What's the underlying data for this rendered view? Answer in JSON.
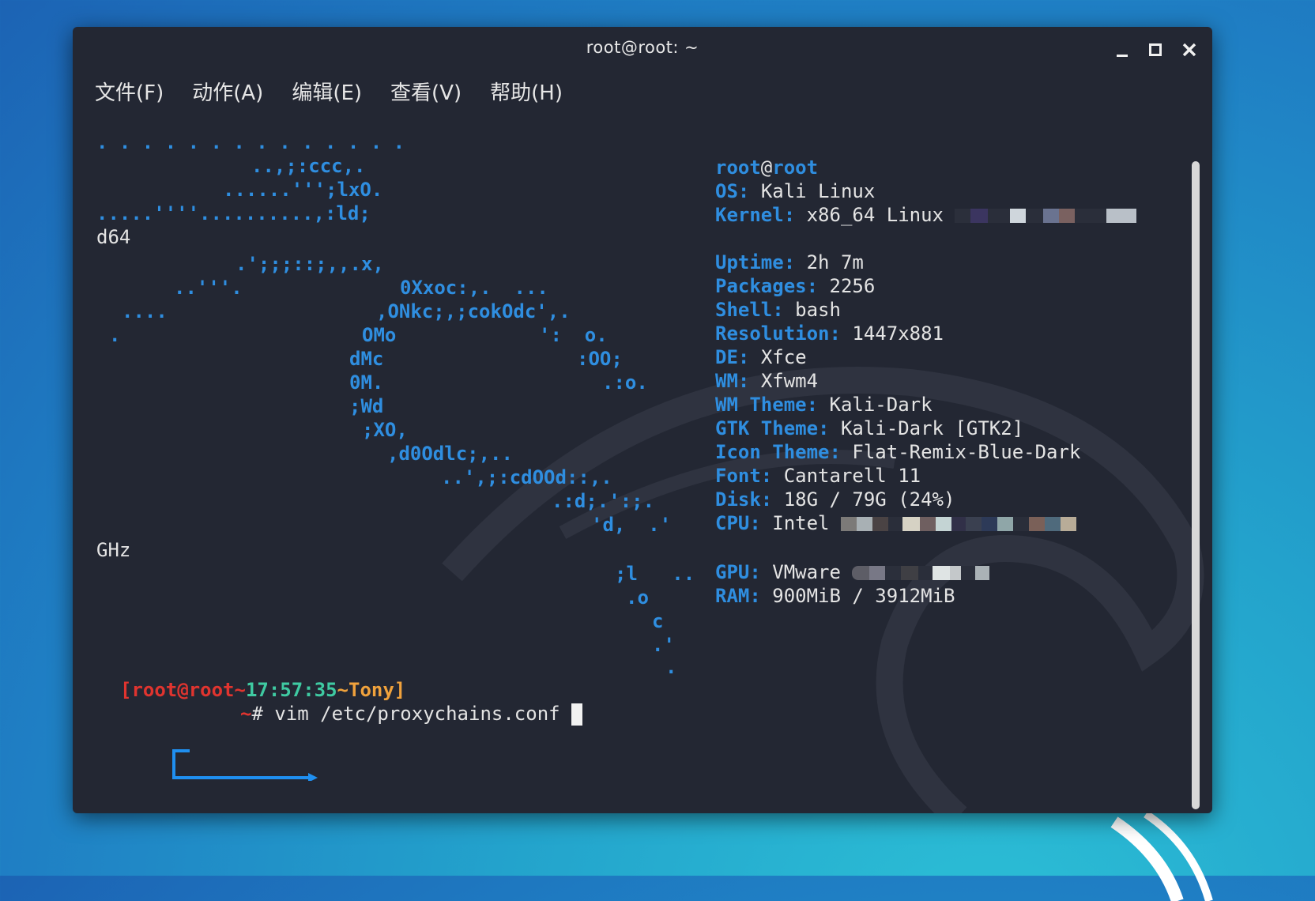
{
  "window": {
    "title": "root@root: ~",
    "controls": {
      "minimize": "minimize-icon",
      "maximize": "maximize-icon",
      "close": "close-icon"
    }
  },
  "menu": [
    "文件(F)",
    "动作(A)",
    "编辑(E)",
    "查看(V)",
    "帮助(H)"
  ],
  "ascii_art": [
    ". . . . . . . . . . . . . .",
    "..,;:ccc,.",
    "......''';lxO.",
    ".....''''..........,:ld;",
    "d64",
    ".';;;::;,,.x,",
    "..'''.",
    "0Xxoc:,.  ...",
    "....",
    ",ONkc;,;cokOdc',.",
    ".",
    "OMo",
    "':  o.",
    "dMc",
    ":OO;",
    "0M.",
    ".:o.",
    ";Wd",
    ";XO,",
    ",d0Odlc;,..",
    "..',;:cdOOd::,.",
    ".:d;.':;.",
    "'d,  .'",
    "GHz",
    ";l   ..",
    ".o",
    "c",
    ".'",
    "."
  ],
  "sysinfo": {
    "user": "root",
    "at": "@",
    "host": "root",
    "rows": [
      {
        "label": "OS:",
        "value": "Kali Linux"
      },
      {
        "label": "Kernel:",
        "value": "x86_64 Linux"
      },
      {
        "label": "Uptime:",
        "value": "2h 7m"
      },
      {
        "label": "Packages:",
        "value": "2256"
      },
      {
        "label": "Shell:",
        "value": "bash"
      },
      {
        "label": "Resolution:",
        "value": "1447x881"
      },
      {
        "label": "DE:",
        "value": "Xfce"
      },
      {
        "label": "WM:",
        "value": "Xfwm4"
      },
      {
        "label": "WM Theme:",
        "value": "Kali-Dark"
      },
      {
        "label": "GTK Theme:",
        "value": "Kali-Dark [GTK2]"
      },
      {
        "label": "Icon Theme:",
        "value": "Flat-Remix-Blue-Dark"
      },
      {
        "label": "Font:",
        "value": "Cantarell 11"
      },
      {
        "label": "Disk:",
        "value": "18G / 79G (24%)"
      },
      {
        "label": "CPU:",
        "value": "Intel"
      },
      {
        "label": "GPU:",
        "value": "VMware"
      },
      {
        "label": "RAM:",
        "value": "900MiB / 3912MiB"
      }
    ]
  },
  "prompt": {
    "open": "[",
    "user_host": "root@root",
    "sep1": "~",
    "time": "17:57:35",
    "sep2": "~",
    "name": "Tony",
    "close": "]",
    "arrow_tilde": "~",
    "hash": "#",
    "command": "vim /etc/proxychains.conf"
  },
  "colors": {
    "window_bg": "#232733",
    "accent_blue": "#2f8ee0",
    "prompt_red": "#e0342f",
    "prompt_green": "#3fcaa2",
    "prompt_orange": "#f0a23c"
  }
}
